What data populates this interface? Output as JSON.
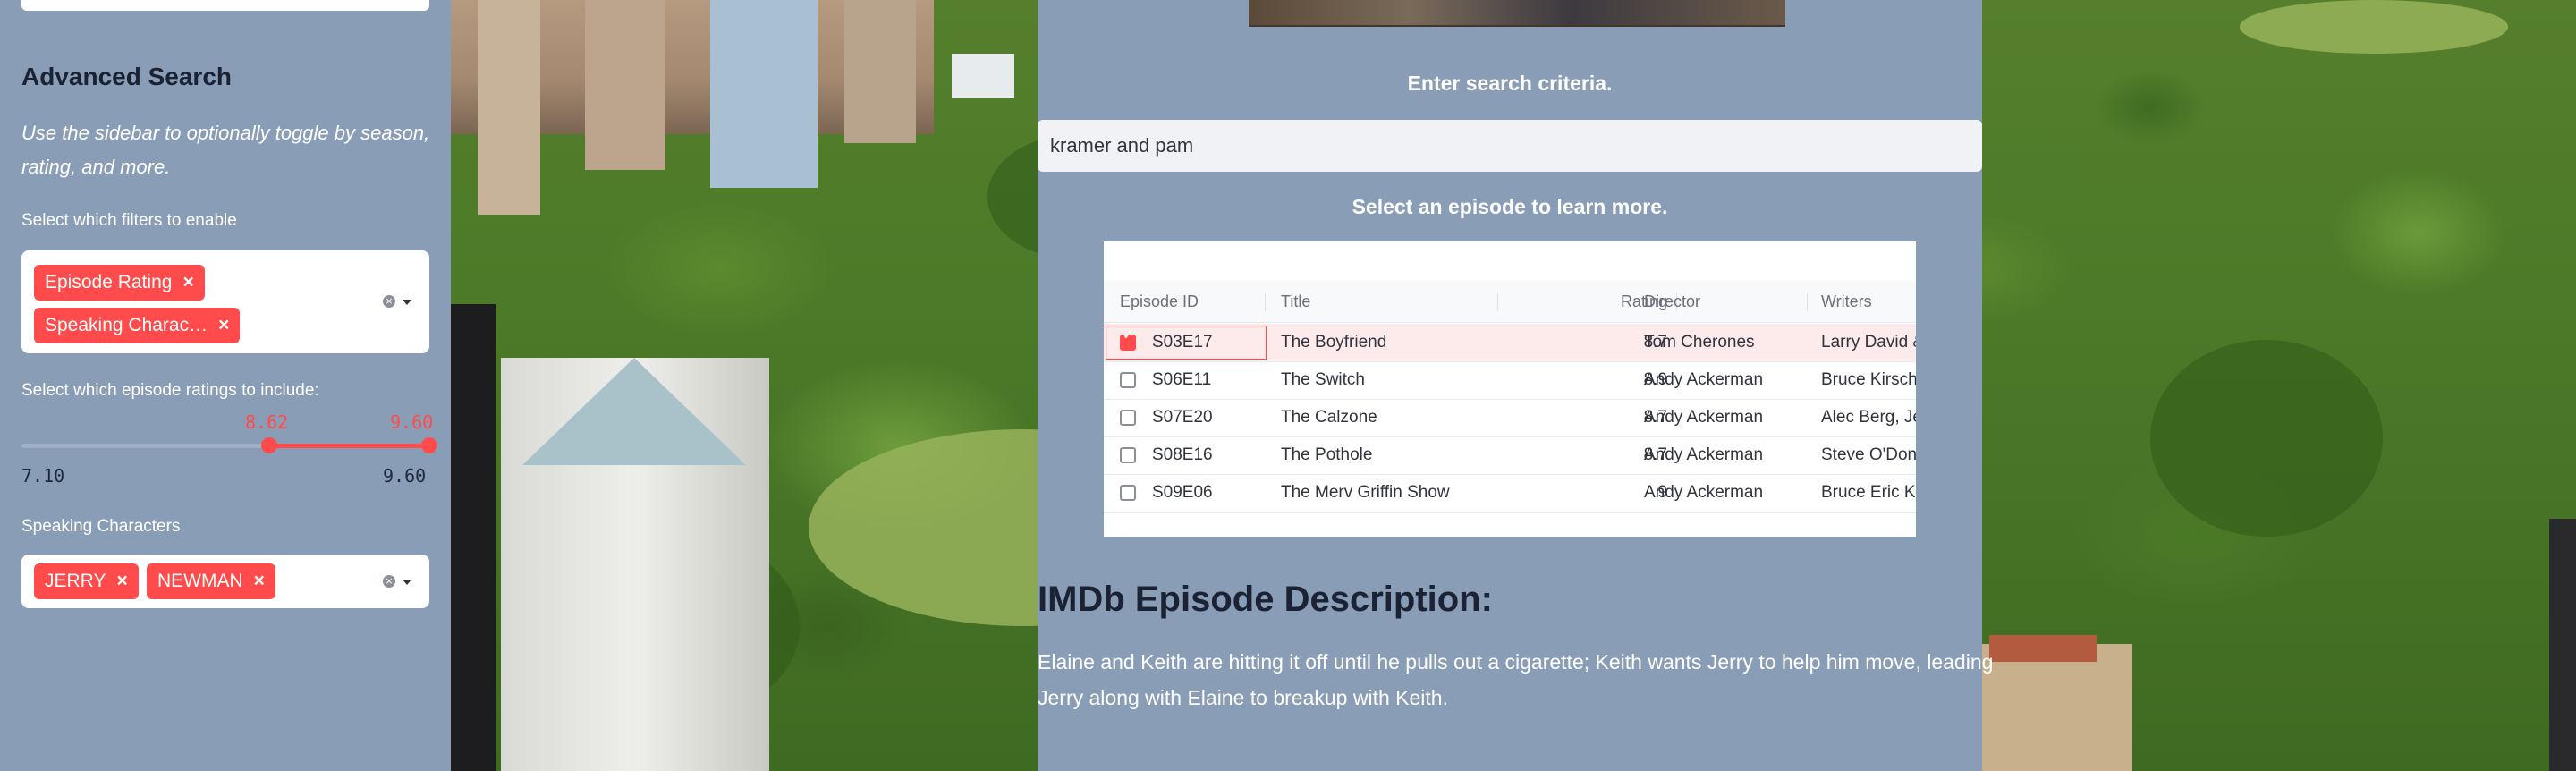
{
  "sidebar": {
    "heading": "Advanced Search",
    "description": "Use the sidebar to optionally toggle by season, rating, and more.",
    "filters_label": "Select which filters to enable",
    "filters": [
      "Episode Rating",
      "Speaking Charac…"
    ],
    "ratings_label": "Select which episode ratings to include:",
    "rating_slider": {
      "min": "7.10",
      "max": "9.60",
      "low": "8.62",
      "high": "9.60",
      "low_fraction": 0.608,
      "high_fraction": 1.0
    },
    "characters_label": "Speaking Characters",
    "characters": [
      "JERRY",
      "NEWMAN"
    ],
    "remove_glyph": "×"
  },
  "main": {
    "search_prompt": "Enter search criteria.",
    "search_value": "kramer and pam",
    "select_prompt": "Select an episode to learn more.",
    "table": {
      "columns": [
        "Episode ID",
        "Title",
        "Rating",
        "Director",
        "Writers"
      ],
      "rows": [
        {
          "id": "S03E17",
          "title": "The Boyfriend",
          "rating": "8.7",
          "director": "Tom Cherones",
          "writers": "Larry David & ...",
          "selected": true
        },
        {
          "id": "S06E11",
          "title": "The Switch",
          "rating": "8.9",
          "director": "Andy Ackerman",
          "writers": "Bruce Kirschbaum",
          "selected": false
        },
        {
          "id": "S07E20",
          "title": "The Calzone",
          "rating": "8.7",
          "director": "Andy Ackerman",
          "writers": "Alec Berg, Jeff Schaffer",
          "selected": false
        },
        {
          "id": "S08E16",
          "title": "The Pothole",
          "rating": "8.7",
          "director": "Andy Ackerman",
          "writers": "Steve O'Donnell",
          "selected": false
        },
        {
          "id": "S09E06",
          "title": "The Merv Griffin Show",
          "rating": "9",
          "director": "Andy Ackerman",
          "writers": "Bruce Eric Kaplan",
          "selected": false
        }
      ]
    },
    "description_heading": "IMDb Episode Description:",
    "description_text": "Elaine and Keith are hitting it off until he pulls out a cigarette; Keith wants Jerry to help him move, leading Jerry along with Elaine to breakup with Keith."
  },
  "colors": {
    "accent": "#ff4b4b",
    "panel": "#8a9db6"
  }
}
